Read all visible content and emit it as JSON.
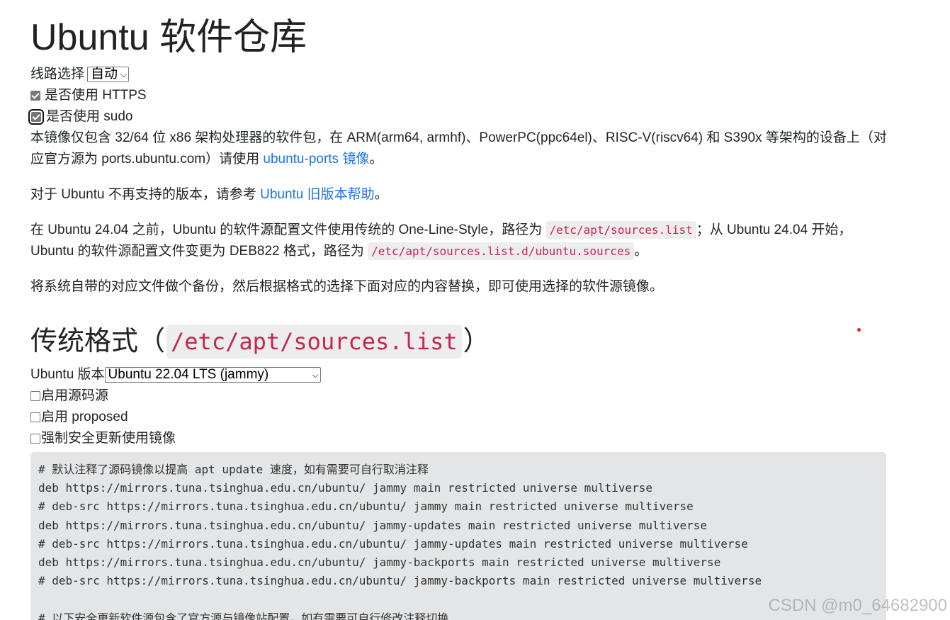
{
  "page_title": "Ubuntu 软件仓库",
  "line_select": {
    "label": "线路选择",
    "value": "自动"
  },
  "options": {
    "https_label": "是否使用 HTTPS",
    "https_checked": true,
    "sudo_label": "是否使用 sudo",
    "sudo_checked": true
  },
  "intro": {
    "p1_text": "本镜像仅包含 32/64 位 x86 架构处理器的软件包，在 ARM(arm64, armhf)、PowerPC(ppc64el)、RISC-V(riscv64) 和 S390x 等架构的设备上（对应官方源为 ports.ubuntu.com）请使用 ",
    "p1_link": "ubuntu-ports 镜像",
    "p1_end": "。",
    "p2_text": "对于 Ubuntu 不再支持的版本，请参考 ",
    "p2_link": "Ubuntu 旧版本帮助",
    "p2_end": "。",
    "p3_a": "在 Ubuntu 24.04 之前，Ubuntu 的软件源配置文件使用传统的 One-Line-Style，路径为 ",
    "p3_code1": "/etc/apt/sources.list",
    "p3_b": "；从 Ubuntu 24.04 开始，Ubuntu 的软件源配置文件变更为 DEB822 格式，路径为 ",
    "p3_code2": "/etc/apt/sources.list.d/ubuntu.sources",
    "p3_end": "。",
    "p4_text": "将系统自带的对应文件做个备份，然后根据格式的选择下面对应的内容替换，即可使用选择的软件源镜像。"
  },
  "section": {
    "title_prefix": "传统格式（",
    "title_code": "/etc/apt/sources.list",
    "title_suffix": "）",
    "version_label": "Ubuntu 版本",
    "version_value": "Ubuntu 22.04 LTS (jammy)",
    "enable_source_label": "启用源码源",
    "enable_proposed_label": "启用 proposed",
    "force_security_label": "强制安全更新使用镜像"
  },
  "code_lines": [
    "# 默认注释了源码镜像以提高 apt update 速度，如有需要可自行取消注释",
    "deb https://mirrors.tuna.tsinghua.edu.cn/ubuntu/ jammy main restricted universe multiverse",
    "# deb-src https://mirrors.tuna.tsinghua.edu.cn/ubuntu/ jammy main restricted universe multiverse",
    "deb https://mirrors.tuna.tsinghua.edu.cn/ubuntu/ jammy-updates main restricted universe multiverse",
    "# deb-src https://mirrors.tuna.tsinghua.edu.cn/ubuntu/ jammy-updates main restricted universe multiverse",
    "deb https://mirrors.tuna.tsinghua.edu.cn/ubuntu/ jammy-backports main restricted universe multiverse",
    "# deb-src https://mirrors.tuna.tsinghua.edu.cn/ubuntu/ jammy-backports main restricted universe multiverse",
    "",
    "# 以下安全更新软件源包含了官方源与镜像站配置，如有需要可自行修改注释切换"
  ],
  "watermark": "CSDN @m0_64682900",
  "colors": {
    "link": "#1a73e8",
    "inline_code": "#c7254e",
    "code_bg": "#e4e5e6"
  }
}
